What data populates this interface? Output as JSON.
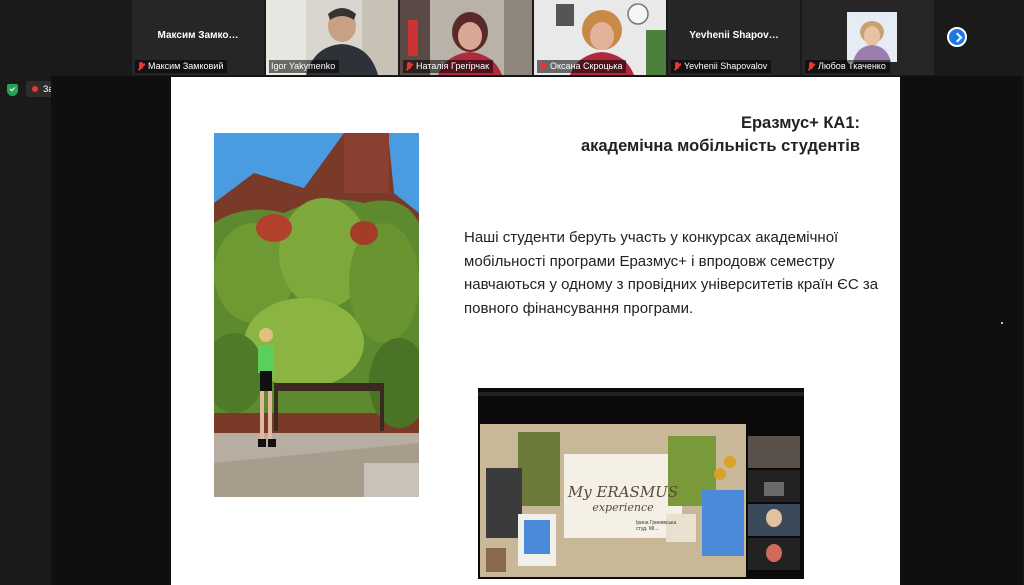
{
  "participants": [
    {
      "display_name": "Максим  Замко…",
      "caption": "Максим Замковий",
      "muted": true
    },
    {
      "display_name": "",
      "caption": "Igor Yakymenko",
      "muted": false
    },
    {
      "display_name": "",
      "caption": "Наталія Грегірчак",
      "muted": true
    },
    {
      "display_name": "",
      "caption": "Оксана Скроцька",
      "muted": true
    },
    {
      "display_name": "Yevhenii  Shapov…",
      "caption": "Yevhenii Shapovalov",
      "muted": true
    },
    {
      "display_name": "",
      "caption": "Любов Ткаченко",
      "muted": true
    }
  ],
  "recording": {
    "label": "Запись"
  },
  "slide": {
    "title_line1": "Еразмус+ КА1:",
    "title_line2": "академічна мобільність студентів",
    "body": "Наші студенти беруть участь у конкурсах академічної мобільності програми Еразмус+ і впродовж семестру навчаються у одному з провідних університетів країн ЄС за повного фінансування програми."
  },
  "embedded_video": {
    "title_line1": "My ERASMUS",
    "title_line2": "experience",
    "note_line1": "Ірина Гриневська",
    "note_line2": "студ. МІ...",
    "accent_color": "#c9b48a"
  },
  "colors": {
    "zoom_blue": "#1e7ae0",
    "mute_red": "#e33333",
    "rec_green": "#21a453"
  }
}
